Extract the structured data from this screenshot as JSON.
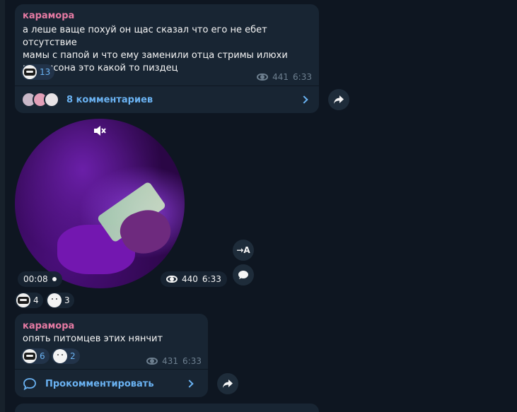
{
  "message1": {
    "sender": "карамора",
    "text_lines": [
      "а леше ваще похуй он щас сказал что его не ебет отсутствие",
      "мамы с папой и что ему заменили отца стримы илюхи",
      "мэддисона это какой то пиздец"
    ],
    "reactions": [
      {
        "emoji": "skull-face",
        "count": "13"
      }
    ],
    "views": "441",
    "time": "6:33",
    "comments_label": "8 комментариев"
  },
  "video_message": {
    "duration": "00:08",
    "views": "440",
    "time": "6:33",
    "reactions": [
      {
        "emoji": "skull-face",
        "count": "4"
      },
      {
        "emoji": "ghost-face",
        "count": "3"
      }
    ],
    "translate_label": "→A"
  },
  "message2": {
    "sender": "карамора",
    "text": "опять питомцев этих нянчит",
    "reactions": [
      {
        "emoji": "skull-face",
        "count": "6"
      },
      {
        "emoji": "ghost-face",
        "count": "2"
      }
    ],
    "views": "431",
    "time": "6:33",
    "comment_label": "Прокомментировать"
  },
  "colors": {
    "background": "#0e1621",
    "bubble": "#182533",
    "sender": "#e57aa3",
    "link": "#6ab2f2",
    "meta": "#6d7f8f"
  }
}
